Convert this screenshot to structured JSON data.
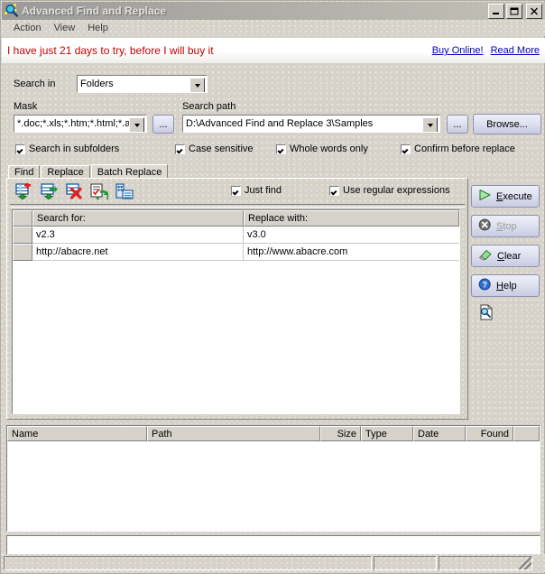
{
  "window": {
    "title": "Advanced Find and Replace",
    "icon": "magnifier-icon",
    "minimize_label": "_",
    "maximize_label": "□",
    "close_label": "✕"
  },
  "menu": {
    "items": [
      {
        "label": "Action"
      },
      {
        "label": "View"
      },
      {
        "label": "Help"
      }
    ]
  },
  "banner": {
    "nag_text": "I have just 21 days to try, before I will buy it",
    "buy_link": "Buy Online!",
    "read_link": "Read More",
    "nag_color": "#c00000",
    "link_color": "#0000c0"
  },
  "options": {
    "search_in_label": "Search in",
    "search_in_value": "Folders",
    "mask_label": "Mask",
    "mask_value": "*.doc;*.xls;*.htm;*.html;*.as",
    "mask_browse_label": "...",
    "search_path_label": "Search path",
    "search_path_value": "D:\\Advanced Find and Replace 3\\Samples",
    "path_browse_dots_label": "...",
    "browse_label": "Browse...",
    "checkboxes": [
      {
        "label": "Search in subfolders",
        "checked": true
      },
      {
        "label": "Case sensitive",
        "checked": true
      },
      {
        "label": "Whole words only",
        "checked": true
      },
      {
        "label": "Confirm before replace",
        "checked": true
      }
    ]
  },
  "tabs": [
    {
      "label": "Find",
      "active": false
    },
    {
      "label": "Replace",
      "active": false
    },
    {
      "label": "Batch Replace",
      "active": true
    }
  ],
  "toolbar": {
    "icons": [
      {
        "name": "add-row-icon"
      },
      {
        "name": "edit-row-icon"
      },
      {
        "name": "delete-row-icon"
      },
      {
        "name": "import-list-icon"
      },
      {
        "name": "export-list-icon"
      }
    ],
    "checkboxes": [
      {
        "label": "Just find",
        "checked": true
      },
      {
        "label": "Use regular expressions",
        "checked": true
      }
    ]
  },
  "grid": {
    "columns": [
      "Search for:",
      "Replace with:"
    ],
    "rows": [
      {
        "search_for": "v2.3",
        "replace_with": "v3.0"
      },
      {
        "search_for": "http://abacre.net",
        "replace_with": "http://www.abacre.com"
      }
    ]
  },
  "actions": {
    "buttons": [
      {
        "label": "Execute",
        "accel": "E",
        "icon": "play-icon",
        "disabled": false
      },
      {
        "label": "Stop",
        "accel": "S",
        "icon": "stop-icon",
        "disabled": true
      },
      {
        "label": "Clear",
        "accel": "C",
        "icon": "eraser-icon",
        "disabled": false
      },
      {
        "label": "Help",
        "accel": "H",
        "icon": "question-icon",
        "disabled": false
      }
    ],
    "extra_icon": "document-search-icon"
  },
  "results": {
    "columns": [
      {
        "label": "Name",
        "align": "left"
      },
      {
        "label": "Path",
        "align": "left"
      },
      {
        "label": "Size",
        "align": "right"
      },
      {
        "label": "Type",
        "align": "left"
      },
      {
        "label": "Date",
        "align": "left"
      },
      {
        "label": "Found",
        "align": "right"
      },
      {
        "label": "",
        "align": "left"
      }
    ],
    "rows": []
  },
  "preview": {
    "text": ""
  },
  "statusbar": {
    "panels": [
      "",
      "",
      ""
    ]
  },
  "theme": {
    "face": "#d4d0c8",
    "window": "#ffffff",
    "shadow": "#808080",
    "highlight": "#ffffff",
    "title_text": "#e2e0dc"
  }
}
